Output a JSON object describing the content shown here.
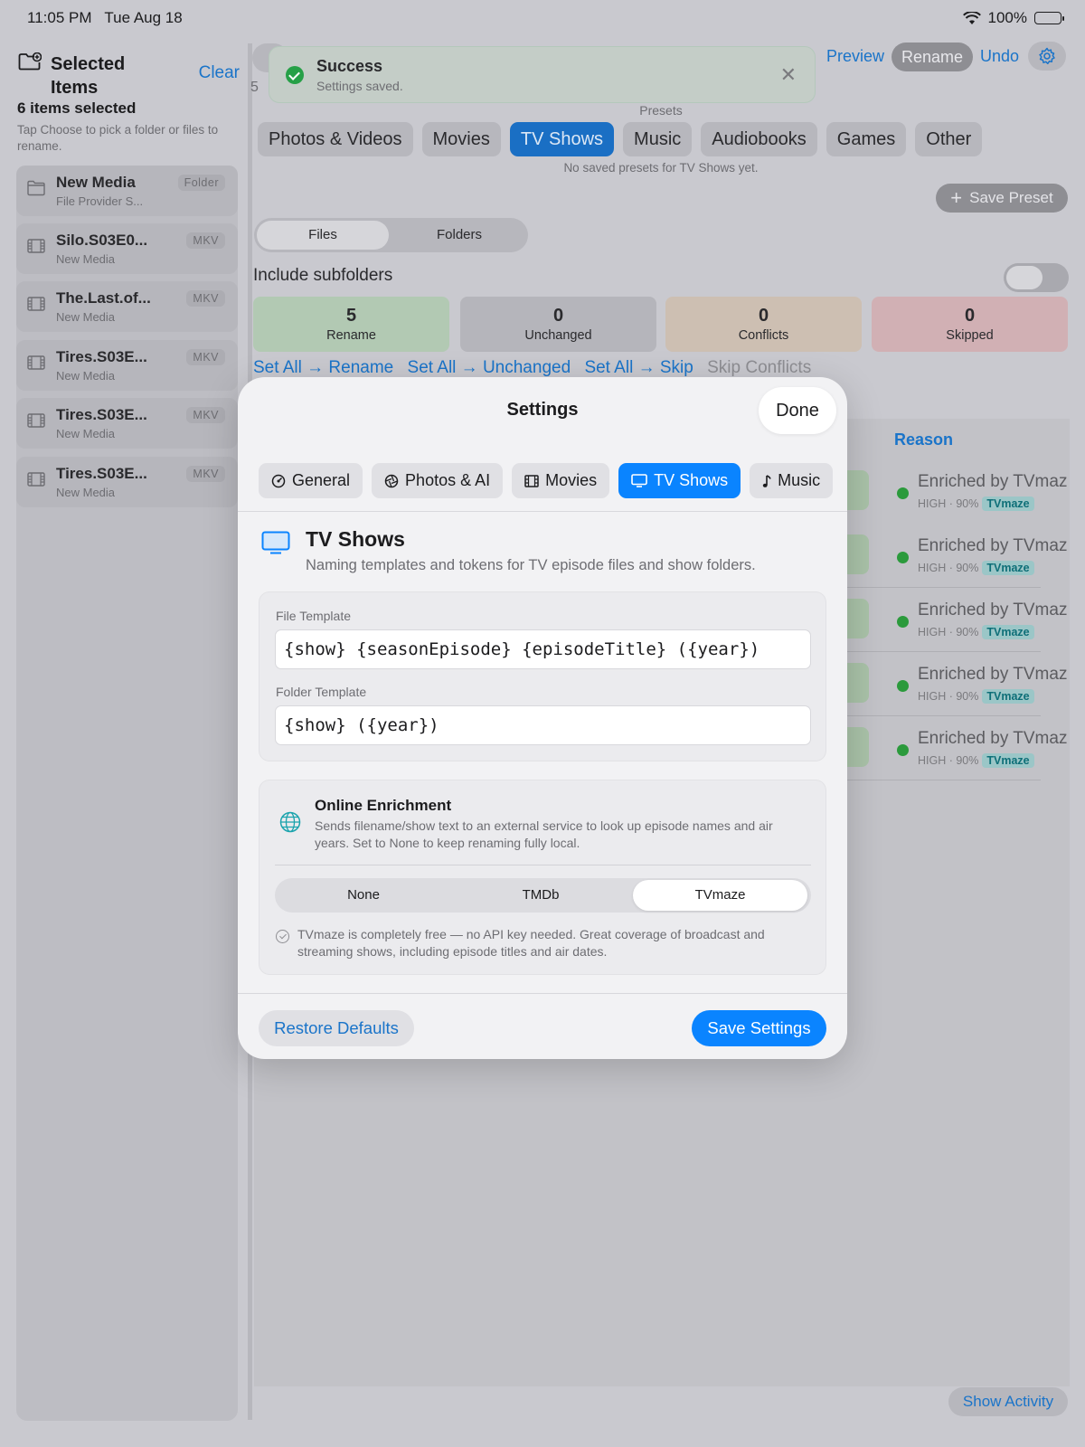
{
  "status": {
    "time": "11:05 PM",
    "date": "Tue Aug 18",
    "battery": "100%"
  },
  "sidebar": {
    "title": "Selected Items",
    "clear": "Clear",
    "count": "6 items selected",
    "hint": "Tap Choose to pick a folder or files to rename.",
    "items": [
      {
        "name": "New Media",
        "sub": "File Provider S...",
        "badge": "Folder",
        "icon": "folder-icon"
      },
      {
        "name": "Silo.S03E0...",
        "sub": "New Media",
        "badge": "MKV",
        "icon": "film-icon"
      },
      {
        "name": "The.Last.of...",
        "sub": "New Media",
        "badge": "MKV",
        "icon": "film-icon"
      },
      {
        "name": "Tires.S03E...",
        "sub": "New Media",
        "badge": "MKV",
        "icon": "film-icon"
      },
      {
        "name": "Tires.S03E...",
        "sub": "New Media",
        "badge": "MKV",
        "icon": "film-icon"
      },
      {
        "name": "Tires.S03E...",
        "sub": "New Media",
        "badge": "MKV",
        "icon": "film-icon"
      }
    ]
  },
  "toolbar": {
    "preview": "Preview",
    "rename": "Rename",
    "undo": "Undo",
    "count_fragment": "5"
  },
  "presets": {
    "label": "Presets",
    "chips": [
      "Photos & Videos",
      "Movies",
      "TV Shows",
      "Music",
      "Audiobooks",
      "Games",
      "Other"
    ],
    "active": "TV Shows",
    "empty": "No saved presets for TV Shows yet.",
    "save": "Save Preset"
  },
  "scope": {
    "files": "Files",
    "folders": "Folders",
    "selected": "Files"
  },
  "include_subfolders": "Include subfolders",
  "stats": [
    {
      "n": "5",
      "l": "Rename",
      "color": "#b2c9b3"
    },
    {
      "n": "0",
      "l": "Unchanged",
      "color": "#b5b5bb"
    },
    {
      "n": "0",
      "l": "Conflicts",
      "color": "#cdbfb2"
    },
    {
      "n": "0",
      "l": "Skipped",
      "color": "#d1b0b4"
    }
  ],
  "set_all": {
    "rename": "Set All → Rename",
    "unchanged": "Set All → Unchanged",
    "skip": "Set All → Skip",
    "skip_conflicts": "Skip Conflicts"
  },
  "results": {
    "reason_header": "Reason",
    "rows": [
      {
        "title": "Enriched by TVmaz",
        "meta": "HIGH · 90%",
        "tag": "TVmaze"
      },
      {
        "title": "Enriched by TVmaz",
        "meta": "HIGH · 90%",
        "tag": "TVmaze"
      },
      {
        "title": "Enriched by TVmaz",
        "meta": "HIGH · 90%",
        "tag": "TVmaze"
      },
      {
        "title": "Enriched by TVmaz",
        "meta": "HIGH · 90%",
        "tag": "TVmaze"
      },
      {
        "title": "Enriched by TVmaz",
        "meta": "HIGH · 90%",
        "tag": "TVmaze"
      }
    ],
    "show_activity": "Show Activity"
  },
  "toast": {
    "title": "Success",
    "message": "Settings saved."
  },
  "settings": {
    "title": "Settings",
    "done": "Done",
    "tabs": [
      {
        "label": "General",
        "icon": "dial-icon"
      },
      {
        "label": "Photos & AI",
        "icon": "aperture-icon"
      },
      {
        "label": "Movies",
        "icon": "film-icon"
      },
      {
        "label": "TV Shows",
        "icon": "tv-icon"
      },
      {
        "label": "Music",
        "icon": "music-note-icon"
      }
    ],
    "active_tab": "TV Shows",
    "section": {
      "title": "TV Shows",
      "desc": "Naming templates and tokens for TV episode files and show folders."
    },
    "file_template_label": "File Template",
    "file_template": "{show} {seasonEpisode} {episodeTitle} ({year})",
    "folder_template_label": "Folder Template",
    "folder_template": "{show} ({year})",
    "enrichment": {
      "title": "Online Enrichment",
      "desc": "Sends filename/show text to an external service to look up episode names and air years. Set to None to keep renaming fully local.",
      "options": [
        "None",
        "TMDb",
        "TVmaze"
      ],
      "selected": "TVmaze",
      "note": "TVmaze is completely free — no API key needed. Great coverage of broadcast and streaming shows, including episode titles and air dates."
    },
    "restore": "Restore Defaults",
    "save": "Save Settings"
  },
  "colors": {
    "accent": "#0a84ff",
    "success": "#26a047",
    "tag": "#0e6f78"
  }
}
